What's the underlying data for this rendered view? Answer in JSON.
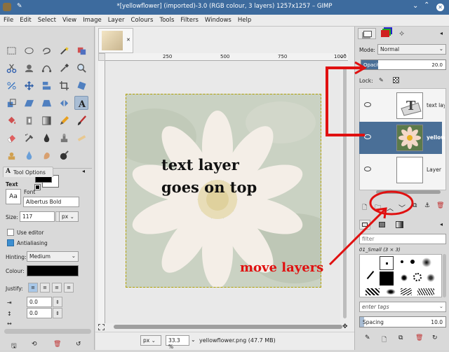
{
  "window": {
    "title": "*[yellowflower] (imported)-3.0 (RGB colour, 3 layers) 1257x1257 – GIMP"
  },
  "menu": [
    "File",
    "Edit",
    "Select",
    "View",
    "Image",
    "Layer",
    "Colours",
    "Tools",
    "Filters",
    "Windows",
    "Help"
  ],
  "ruler": {
    "ticks": [
      "250",
      "500",
      "750",
      "1000"
    ]
  },
  "tool_options": {
    "tab_label": "Tool Options",
    "section": "Text",
    "font_label": "Font",
    "font_value": "Albertus Bold",
    "size_label": "Size:",
    "size_value": "117",
    "size_unit": "px",
    "use_editor": "Use editor",
    "antialiasing": "Antialiasing",
    "hinting_label": "Hinting:",
    "hinting_value": "Medium",
    "colour_label": "Colour:",
    "justify_label": "Justify:",
    "indent_value": "0.0",
    "spacing_value": "0.0",
    "aa_glyph": "Aa"
  },
  "canvas": {
    "text_line1": "text layer",
    "text_line2": "goes on top",
    "annotation": "move layers"
  },
  "statusbar": {
    "unit": "px",
    "zoom": "33.3 %",
    "file_info": "yellowflower.png (47.7 MB)"
  },
  "layers_panel": {
    "mode_label": "Mode:",
    "mode_value": "Normal",
    "opacity_label": "Opacity",
    "opacity_value": "20.0",
    "lock_label": "Lock:",
    "layers": [
      {
        "name": "text layer"
      },
      {
        "name": "yellowflower"
      },
      {
        "name": "Layer"
      }
    ]
  },
  "brushes_panel": {
    "filter_placeholder": "filter",
    "brush_name": "01_Small (3 × 3)",
    "tags_placeholder": "enter tags",
    "spacing_label": "Spacing",
    "spacing_value": "10.0"
  },
  "colors": {
    "annotation_red": "#e01010",
    "selection_blue": "#4a6f97",
    "titlebar": "#3d6b9e"
  }
}
